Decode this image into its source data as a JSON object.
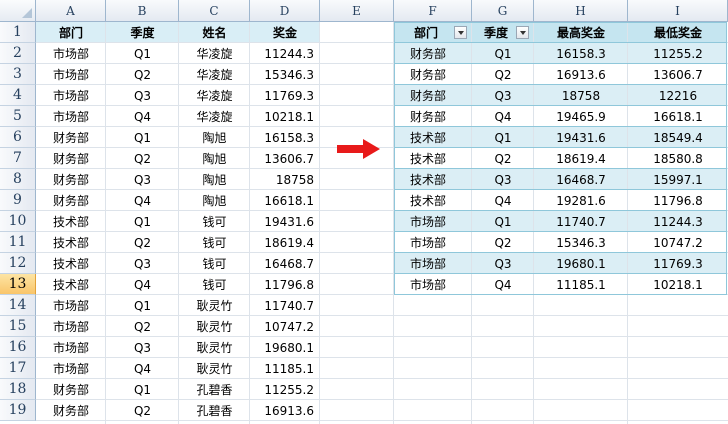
{
  "column_headers": [
    "A",
    "B",
    "C",
    "D",
    "E",
    "F",
    "G",
    "H",
    "I"
  ],
  "row_numbers": [
    "1",
    "2",
    "3",
    "4",
    "5",
    "6",
    "7",
    "8",
    "9",
    "10",
    "11",
    "12",
    "13",
    "14",
    "15",
    "16",
    "17",
    "18",
    "19"
  ],
  "active_row": "13",
  "source": {
    "headers": [
      "部门",
      "季度",
      "姓名",
      "奖金"
    ],
    "rows": [
      [
        "市场部",
        "Q1",
        "华凌旋",
        "11244.3"
      ],
      [
        "市场部",
        "Q2",
        "华凌旋",
        "15346.3"
      ],
      [
        "市场部",
        "Q3",
        "华凌旋",
        "11769.3"
      ],
      [
        "市场部",
        "Q4",
        "华凌旋",
        "10218.1"
      ],
      [
        "财务部",
        "Q1",
        "陶旭",
        "16158.3"
      ],
      [
        "财务部",
        "Q2",
        "陶旭",
        "13606.7"
      ],
      [
        "财务部",
        "Q3",
        "陶旭",
        "18758"
      ],
      [
        "财务部",
        "Q4",
        "陶旭",
        "16618.1"
      ],
      [
        "技术部",
        "Q1",
        "钱可",
        "19431.6"
      ],
      [
        "技术部",
        "Q2",
        "钱可",
        "18619.4"
      ],
      [
        "技术部",
        "Q3",
        "钱可",
        "16468.7"
      ],
      [
        "技术部",
        "Q4",
        "钱可",
        "11796.8"
      ],
      [
        "市场部",
        "Q1",
        "耿灵竹",
        "11740.7"
      ],
      [
        "市场部",
        "Q2",
        "耿灵竹",
        "10747.2"
      ],
      [
        "市场部",
        "Q3",
        "耿灵竹",
        "19680.1"
      ],
      [
        "市场部",
        "Q4",
        "耿灵竹",
        "11185.1"
      ],
      [
        "财务部",
        "Q1",
        "孔碧香",
        "11255.2"
      ],
      [
        "财务部",
        "Q2",
        "孔碧香",
        "16913.6"
      ]
    ]
  },
  "pivot": {
    "headers": [
      "部门",
      "季度",
      "最高奖金",
      "最低奖金"
    ],
    "rows": [
      [
        "财务部",
        "Q1",
        "16158.3",
        "11255.2"
      ],
      [
        "财务部",
        "Q2",
        "16913.6",
        "13606.7"
      ],
      [
        "财务部",
        "Q3",
        "18758",
        "12216"
      ],
      [
        "财务部",
        "Q4",
        "19465.9",
        "16618.1"
      ],
      [
        "技术部",
        "Q1",
        "19431.6",
        "18549.4"
      ],
      [
        "技术部",
        "Q2",
        "18619.4",
        "18580.8"
      ],
      [
        "技术部",
        "Q3",
        "16468.7",
        "15997.1"
      ],
      [
        "技术部",
        "Q4",
        "19281.6",
        "11796.8"
      ],
      [
        "市场部",
        "Q1",
        "11740.7",
        "11244.3"
      ],
      [
        "市场部",
        "Q2",
        "15346.3",
        "10747.2"
      ],
      [
        "市场部",
        "Q3",
        "19680.1",
        "11769.3"
      ],
      [
        "市场部",
        "Q4",
        "11185.1",
        "10218.1"
      ]
    ]
  },
  "colors": {
    "arrow": "#e81a1a",
    "source_header_fill": "#d9eef6",
    "pivot_band": "#dbeef5",
    "active_row": "#f9c56a"
  },
  "icons": {
    "filter_dropdown": "chevron-down-icon",
    "arrow": "right-arrow-icon"
  }
}
